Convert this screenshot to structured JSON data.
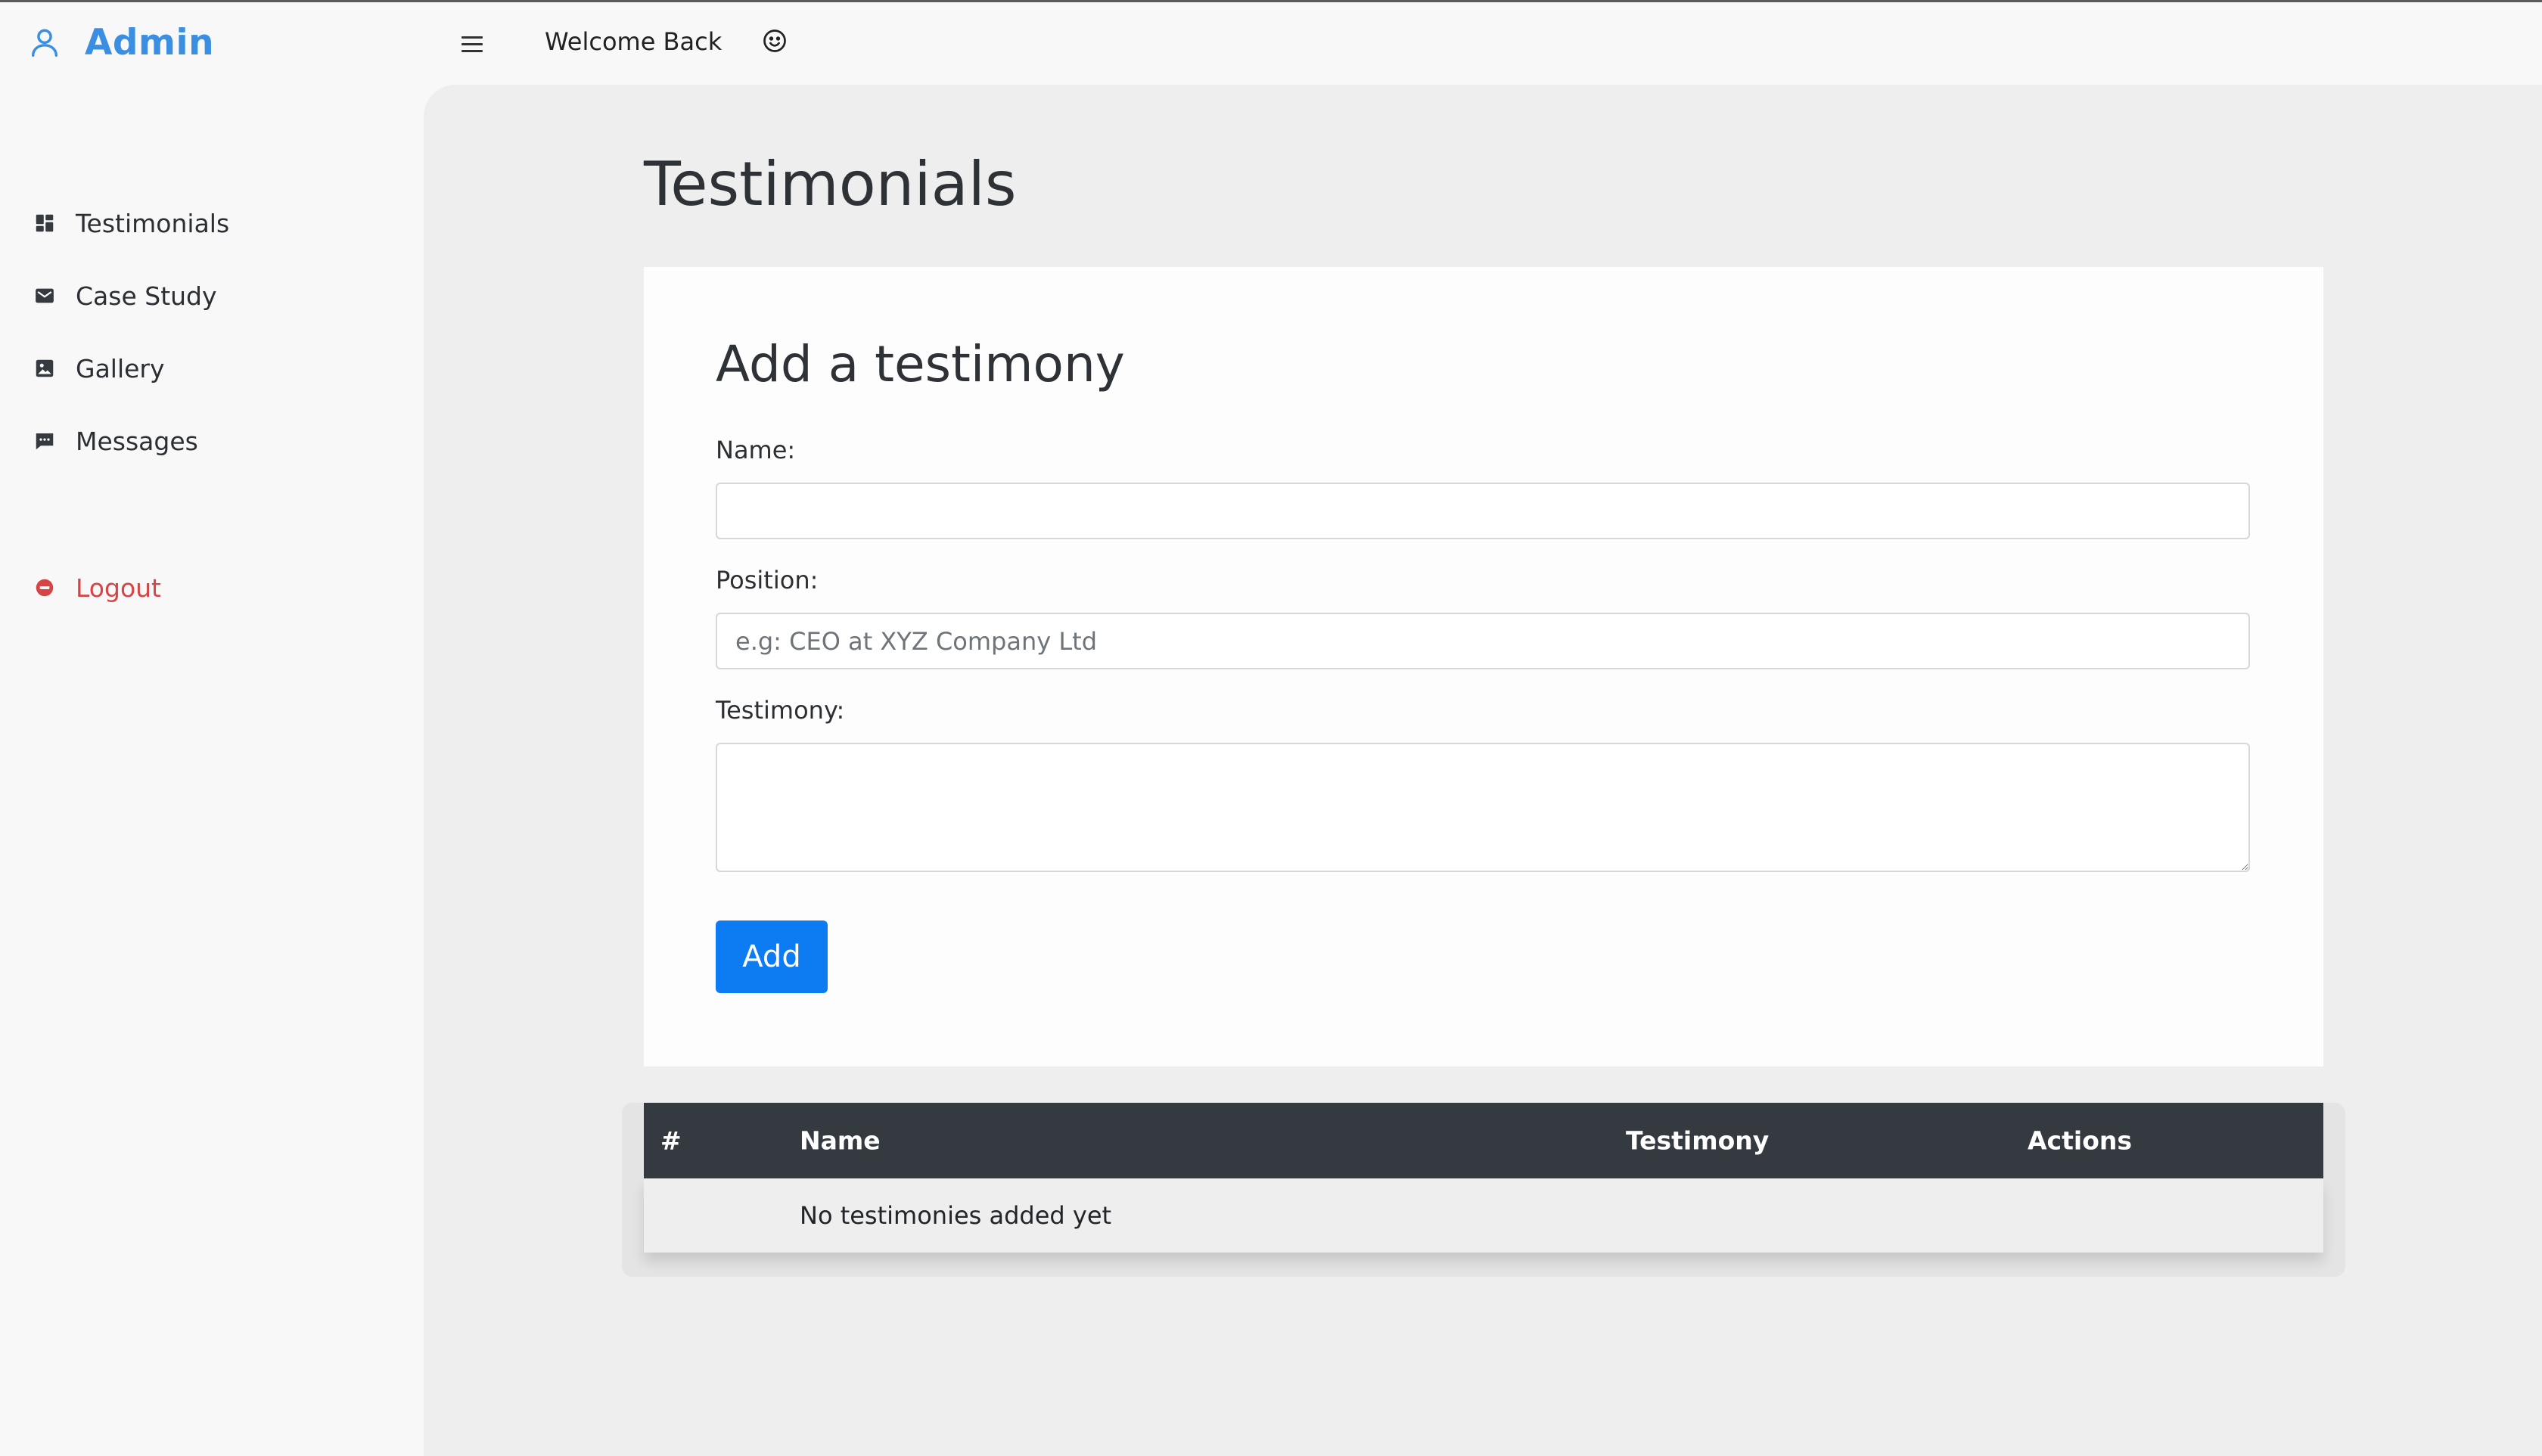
{
  "brand": {
    "title": "Admin",
    "color": "#3a8fe3"
  },
  "topbar": {
    "welcome": "Welcome Back"
  },
  "sidebar": {
    "items": [
      {
        "label": "Testimonials",
        "icon": "dashboard-grid-icon"
      },
      {
        "label": "Case Study",
        "icon": "mail-icon"
      },
      {
        "label": "Gallery",
        "icon": "image-icon"
      },
      {
        "label": "Messages",
        "icon": "chat-icon"
      }
    ],
    "logout": {
      "label": "Logout",
      "icon": "logout-icon",
      "color": "#d64545"
    }
  },
  "page": {
    "title": "Testimonials"
  },
  "form": {
    "title": "Add a testimony",
    "name_label": "Name:",
    "name_value": "",
    "position_label": "Position:",
    "position_placeholder": "e.g: CEO at XYZ Company Ltd",
    "testimony_label": "Testimony:",
    "testimony_value": "",
    "submit_label": "Add",
    "submit_color": "#0d7cf2"
  },
  "table": {
    "headers": [
      "#",
      "Name",
      "Testimony",
      "Actions"
    ],
    "empty_message": "No testimonies added yet"
  }
}
